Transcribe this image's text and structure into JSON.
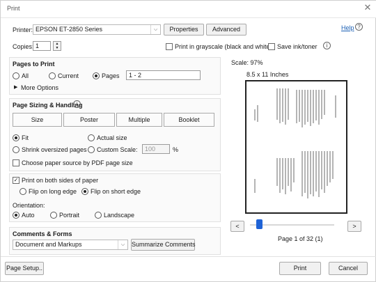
{
  "window": {
    "title": "Print",
    "close_icon": "close-icon"
  },
  "printer": {
    "label": "Printer:",
    "value": "EPSON ET-2850 Series",
    "properties": "Properties",
    "advanced": "Advanced",
    "help": "Help",
    "help_icon": "help-circle-icon"
  },
  "copies": {
    "label": "Copies:",
    "value": "1",
    "grayscale_label": "Print in grayscale (black and white)",
    "grayscale_checked": false,
    "save_ink_label": "Save ink/toner",
    "save_ink_checked": false,
    "info_icon": "info-icon"
  },
  "pages_to_print": {
    "heading": "Pages to Print",
    "all": "All",
    "current": "Current",
    "pages": "Pages",
    "pages_value": "1 - 2",
    "selected": "Pages",
    "more_options": "More Options"
  },
  "sizing": {
    "heading": "Page Sizing & Handling",
    "tabs": [
      "Size",
      "Poster",
      "Multiple",
      "Booklet"
    ],
    "fit": "Fit",
    "actual_size": "Actual size",
    "shrink": "Shrink oversized pages",
    "custom_scale": "Custom Scale:",
    "custom_scale_value": "100",
    "percent": "%",
    "selected": "Fit",
    "paper_source": "Choose paper source by PDF page size",
    "paper_source_checked": false
  },
  "duplex": {
    "label": "Print on both sides of paper",
    "checked": true,
    "long_edge": "Flip on long edge",
    "short_edge": "Flip on short edge",
    "selected": "Flip on short edge"
  },
  "orientation": {
    "label": "Orientation:",
    "auto": "Auto",
    "portrait": "Portrait",
    "landscape": "Landscape",
    "selected": "Auto"
  },
  "comments": {
    "heading": "Comments & Forms",
    "value": "Document and Markups",
    "summarize": "Summarize Comments"
  },
  "preview": {
    "scale": "Scale: 97%",
    "paper": "8.5 x 11 Inches",
    "page_info": "Page 1 of 32 (1)",
    "prev": "<",
    "next": ">"
  },
  "footer": {
    "page_setup": "Page Setup..",
    "print": "Print",
    "cancel": "Cancel"
  }
}
